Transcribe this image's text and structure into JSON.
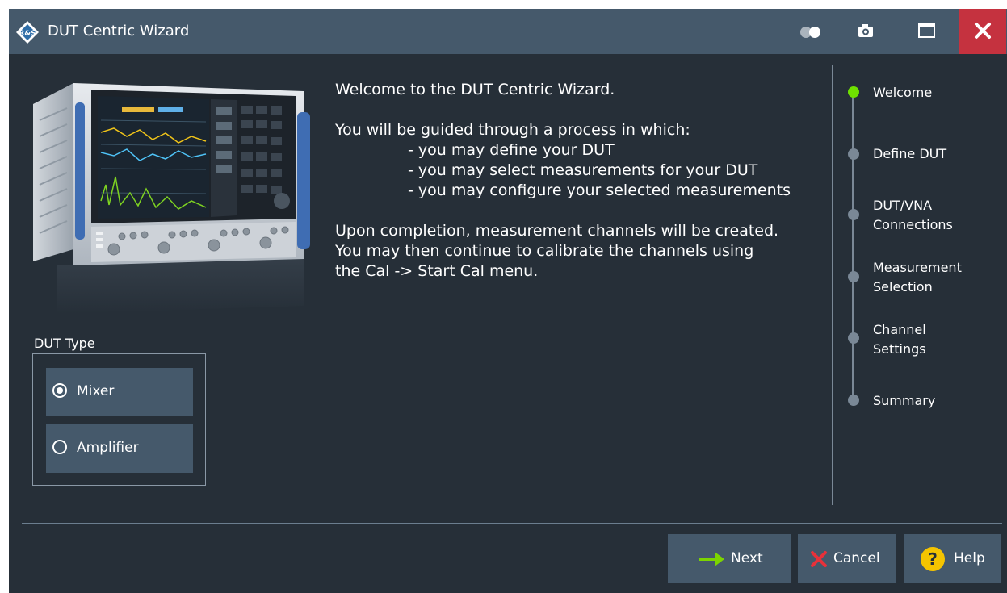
{
  "window": {
    "title": "DUT Centric Wizard",
    "title_bar_buttons": [
      "toggle-icon",
      "camera-icon",
      "maximize-icon",
      "close-icon"
    ]
  },
  "intro": {
    "line1": "Welcome to the DUT Centric Wizard.",
    "line2": "You will be guided through a process in which:",
    "bullet1": "- you may define your DUT",
    "bullet2": "- you may select measurements for your DUT",
    "bullet3": "- you may configure your selected measurements",
    "line3": "Upon completion, measurement channels will be created.",
    "line4": "You may then continue to calibrate the channels using",
    "line5": "the Cal -> Start Cal menu."
  },
  "dut_type": {
    "label": "DUT Type",
    "options": [
      {
        "label": "Mixer",
        "selected": true
      },
      {
        "label": "Amplifier",
        "selected": false
      }
    ]
  },
  "steps": {
    "items": [
      {
        "label": "Welcome",
        "active": true
      },
      {
        "label": "Define DUT",
        "active": false
      },
      {
        "label": "DUT/VNA Connections",
        "active": false
      },
      {
        "label": "Measurement Selection",
        "active": false
      },
      {
        "label": "Channel Settings",
        "active": false
      },
      {
        "label": "Summary",
        "active": false
      }
    ],
    "s1": "Welcome",
    "s2": "Define DUT",
    "s3a": "DUT/VNA",
    "s3b": "Connections",
    "s4a": "Measurement",
    "s4b": "Selection",
    "s5a": "Channel",
    "s5b": "Settings",
    "s6": "Summary"
  },
  "footer": {
    "next_label": "Next",
    "cancel_label": "Cancel",
    "help_label": "Help"
  },
  "colors": {
    "background": "#262f38",
    "titlebar": "#45596b",
    "button": "#45596b",
    "close": "#c5323f",
    "active_step": "#6fe000",
    "next_arrow": "#7cd400",
    "cancel_x": "#e8313a",
    "help_icon": "#f5c400"
  }
}
